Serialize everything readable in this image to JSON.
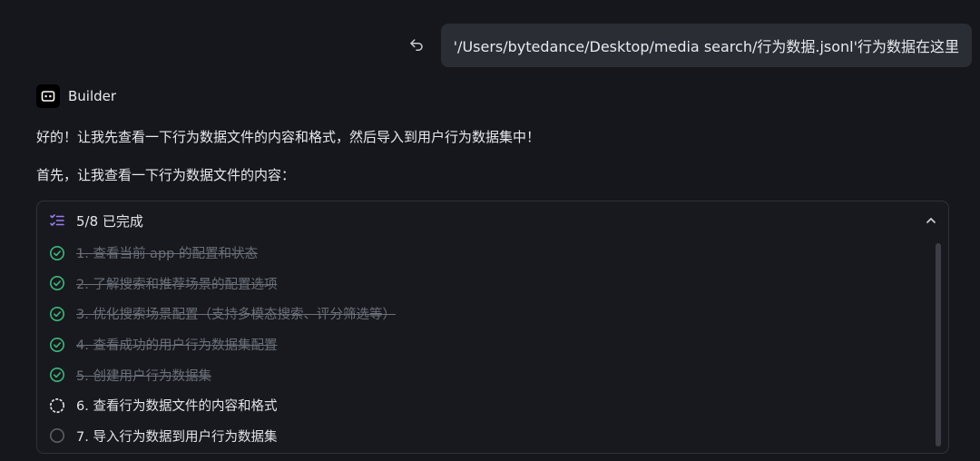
{
  "user_message": {
    "text": "'/Users/bytedance/Desktop/media search/行为数据.jsonl'行为数据在这里",
    "undo_icon": "undo-icon"
  },
  "assistant": {
    "name": "Builder",
    "line1": "好的！让我先查看一下行为数据文件的内容和格式，然后导入到用户行为数据集中！",
    "line2": "首先，让我查看一下行为数据文件的内容："
  },
  "todo": {
    "summary": "5/8 已完成",
    "items": [
      {
        "text": "1. 查看当前 app 的配置和状态",
        "status": "done"
      },
      {
        "text": "2. 了解搜索和推荐场景的配置选项",
        "status": "done"
      },
      {
        "text": "3. 优化搜索场景配置（支持多模态搜索、评分筛选等）",
        "status": "done"
      },
      {
        "text": "4. 查看成功的用户行为数据集配置",
        "status": "done"
      },
      {
        "text": "5. 创建用户行为数据集",
        "status": "done"
      },
      {
        "text": "6. 查看行为数据文件的内容和格式",
        "status": "active"
      },
      {
        "text": "7. 导入行为数据到用户行为数据集",
        "status": "pending"
      }
    ]
  },
  "colors": {
    "done_check": "#3fb77a",
    "active_spinner": "#d9dbe0",
    "pending_circle": "#5b5f66",
    "list_icon": "#9b7cf0"
  }
}
